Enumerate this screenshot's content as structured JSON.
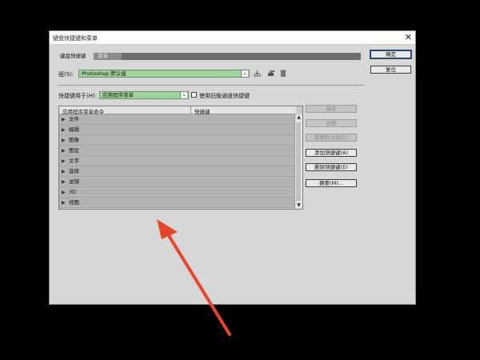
{
  "dialog": {
    "title": "键盘快捷键和菜单",
    "close_glyph": "✕",
    "tabs": [
      "键盘快捷键",
      "菜单"
    ]
  },
  "group": {
    "label": "组(S):",
    "value": "Photoshop 默认值",
    "arrow": "⌄",
    "icons": [
      "save-icon",
      "save-as-icon",
      "trash-icon"
    ]
  },
  "shortcuts_for": {
    "label": "快捷键用于(H):",
    "value": "应用程序菜单",
    "arrow": "⌄",
    "legacy_checkbox_label": "使用旧版通道快捷键",
    "legacy_checked": false
  },
  "table": {
    "headers": [
      "应用程序菜单命令",
      "快捷键"
    ],
    "rows": [
      "文件",
      "编辑",
      "图像",
      "图层",
      "文字",
      "选择",
      "滤镜",
      "3D",
      "视图"
    ],
    "expand_glyph": "▶",
    "scroll_up": "▲",
    "scroll_down": "▼"
  },
  "action_buttons": [
    {
      "label": "接受",
      "enabled": false
    },
    {
      "label": "还原",
      "enabled": false
    },
    {
      "label": "使用默认值(D)",
      "enabled": false
    },
    {
      "label": "添加快捷键(A)",
      "enabled": true
    },
    {
      "label": "删除快捷键(E)",
      "enabled": true
    },
    {
      "label": "摘要(M)...",
      "enabled": true
    }
  ],
  "dialog_buttons": {
    "ok": "确定",
    "reset": "复位"
  },
  "colors": {
    "combo_green": "#9ed39b",
    "annotation_arrow": "#e8452d"
  }
}
